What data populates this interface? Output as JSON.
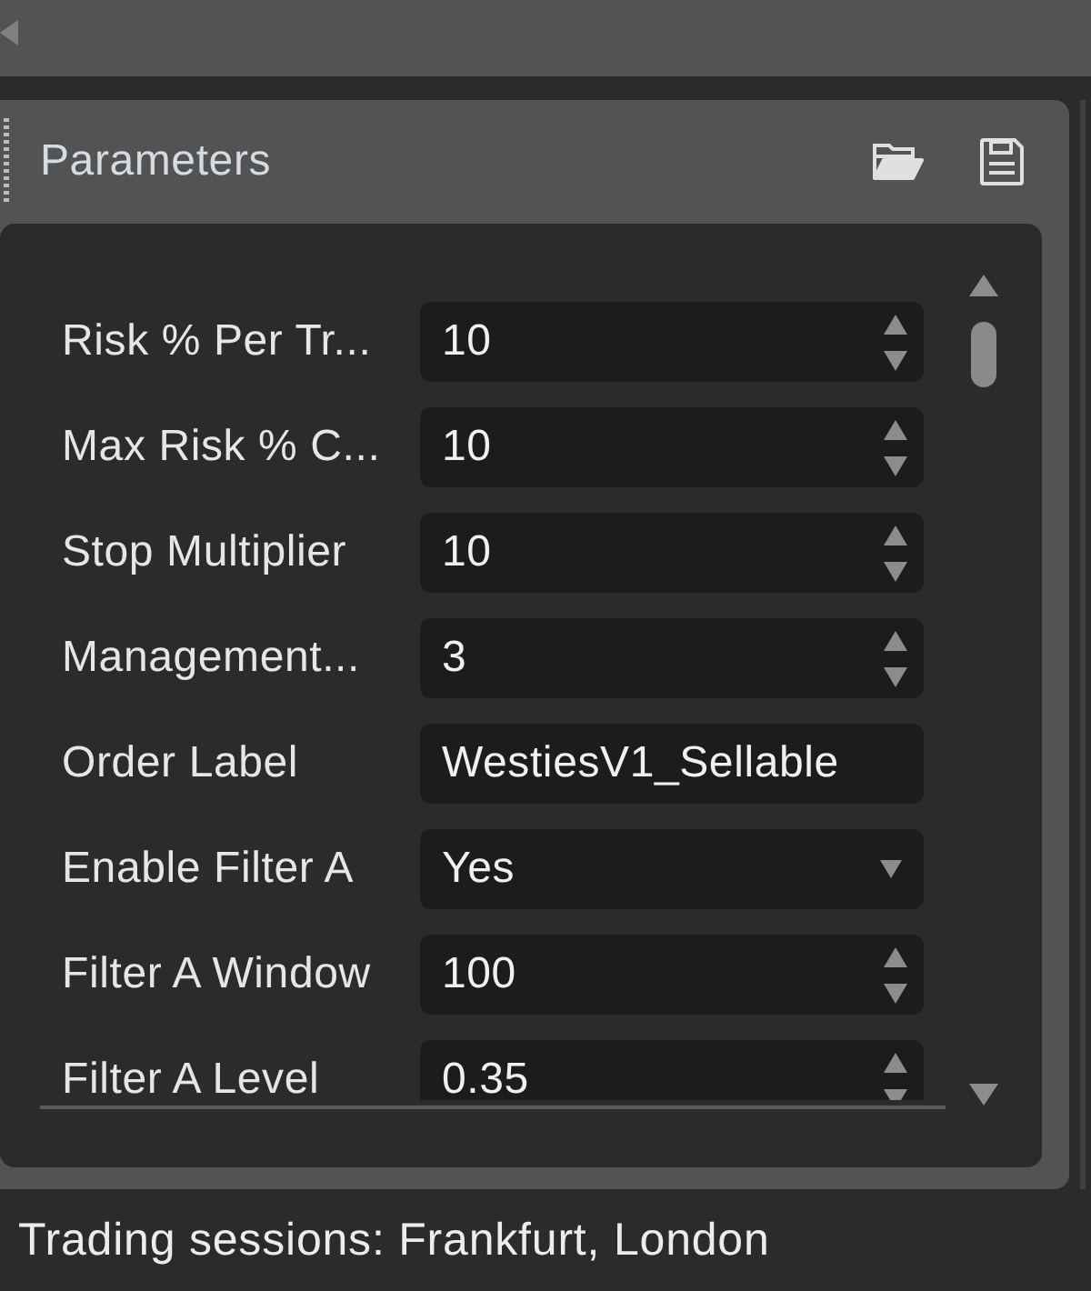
{
  "panel": {
    "title": "Parameters",
    "parameters": [
      {
        "label": "Risk % Per Tr...",
        "kind": "number",
        "value": "10"
      },
      {
        "label": "Max Risk % C...",
        "kind": "number",
        "value": "10"
      },
      {
        "label": "Stop Multiplier",
        "kind": "number",
        "value": "10"
      },
      {
        "label": "Management...",
        "kind": "number",
        "value": "3"
      },
      {
        "label": "Order Label",
        "kind": "text",
        "value": "WestiesV1_Sellable"
      },
      {
        "label": "Enable Filter A",
        "kind": "dropdown",
        "value": "Yes"
      },
      {
        "label": "Filter A Window",
        "kind": "number",
        "value": "100"
      },
      {
        "label": "Filter A Level",
        "kind": "number",
        "value": "0.35"
      }
    ]
  },
  "status_bar": {
    "text": "Trading sessions: Frankfurt, London"
  }
}
